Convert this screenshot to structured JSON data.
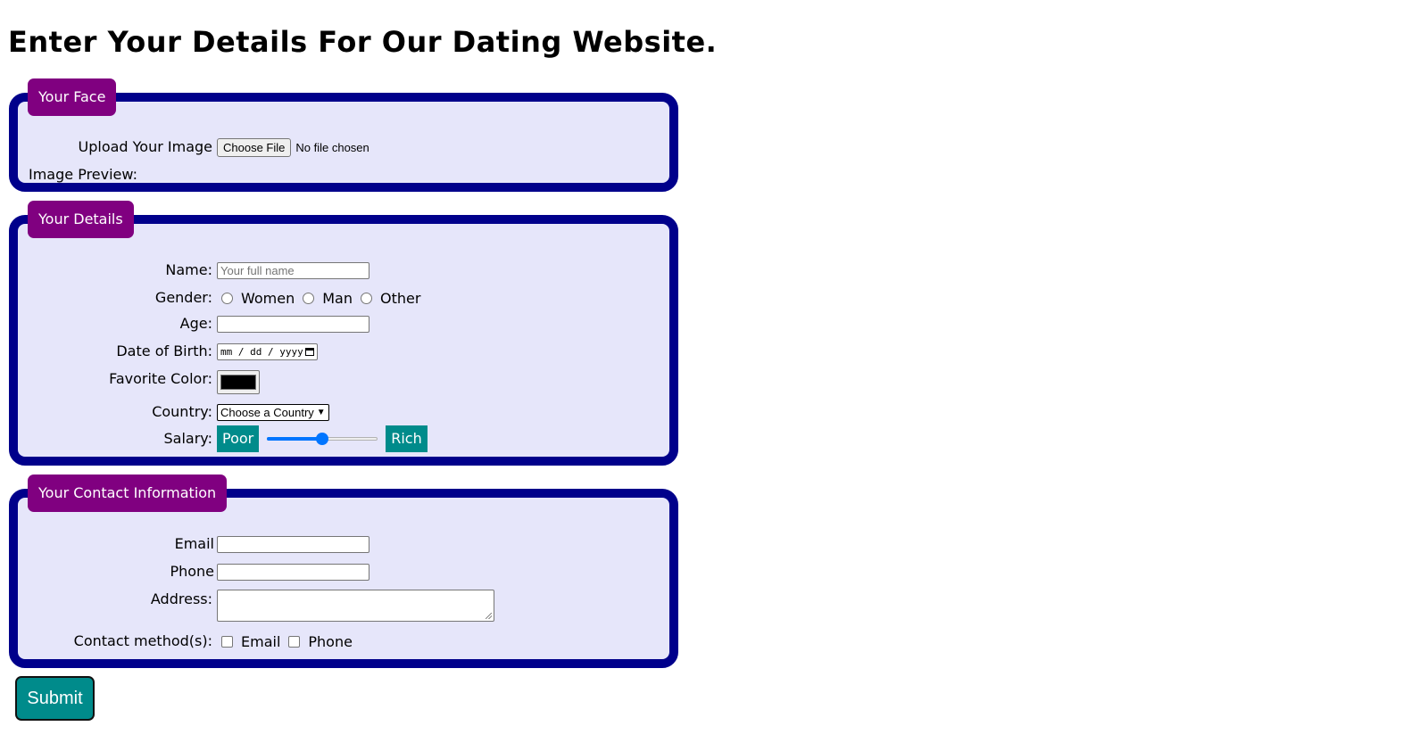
{
  "page": {
    "title": "Enter Your Details For Our Dating Website."
  },
  "face": {
    "legend": "Your Face",
    "upload_label": "Upload Your Image",
    "file_button": "Choose File",
    "file_status": "No file chosen",
    "preview_label": "Image Preview:"
  },
  "details": {
    "legend": "Your Details",
    "name_label": "Name:",
    "name_placeholder": "Your full name",
    "gender_label": "Gender:",
    "gender_options": [
      "Women",
      "Man",
      "Other"
    ],
    "age_label": "Age:",
    "dob_label": "Date of Birth:",
    "dob_placeholder": "mm / dd / yyyy",
    "color_label": "Favorite Color:",
    "color_value": "#000000",
    "country_label": "Country:",
    "country_selected": "Choose a Country",
    "salary_label": "Salary:",
    "salary_min_label": "Poor",
    "salary_max_label": "Rich",
    "salary_value_fraction": 0.5
  },
  "contact": {
    "legend": "Your Contact Information",
    "email_label": "Email",
    "phone_label": "Phone",
    "address_label": "Address:",
    "method_label": "Contact method(s):",
    "method_options": [
      "Email",
      "Phone"
    ]
  },
  "submit": {
    "label": "Submit"
  },
  "colors": {
    "fieldset_border": "#00008b",
    "fieldset_bg": "#e6e6fa",
    "legend_bg": "#800080",
    "accent_teal": "#008b8b",
    "slider_blue": "#0075ff"
  }
}
